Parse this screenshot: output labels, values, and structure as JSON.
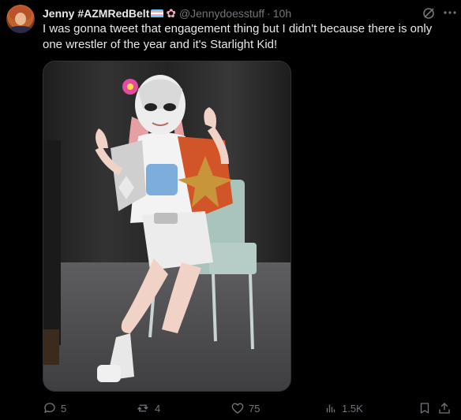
{
  "tweet": {
    "display_name": "Jenny #AZMRedBelt",
    "handle": "@Jennydoesstuff",
    "separator": "·",
    "time": "10h",
    "text": "I was gonna tweet that engagement thing but I didn't because there is only one wrestler of the year and it's Starlight Kid!",
    "flag_colors": [
      "#5bcefa",
      "#f5a9b8",
      "#ffffff",
      "#f5a9b8",
      "#5bcefa"
    ],
    "flower_glyph": "✿"
  },
  "icons": {
    "grok": "grok-icon",
    "more": "more-icon",
    "reply": "reply-icon",
    "retweet": "retweet-icon",
    "like": "heart-icon",
    "views": "views-icon",
    "bookmark": "bookmark-icon",
    "share": "share-icon"
  },
  "actions": {
    "replies": "5",
    "retweets": "4",
    "likes": "75",
    "views": "1.5K"
  },
  "colors": {
    "background": "#000000",
    "text": "#e7e9ea",
    "muted": "#71767b",
    "border": "#2f3336"
  }
}
